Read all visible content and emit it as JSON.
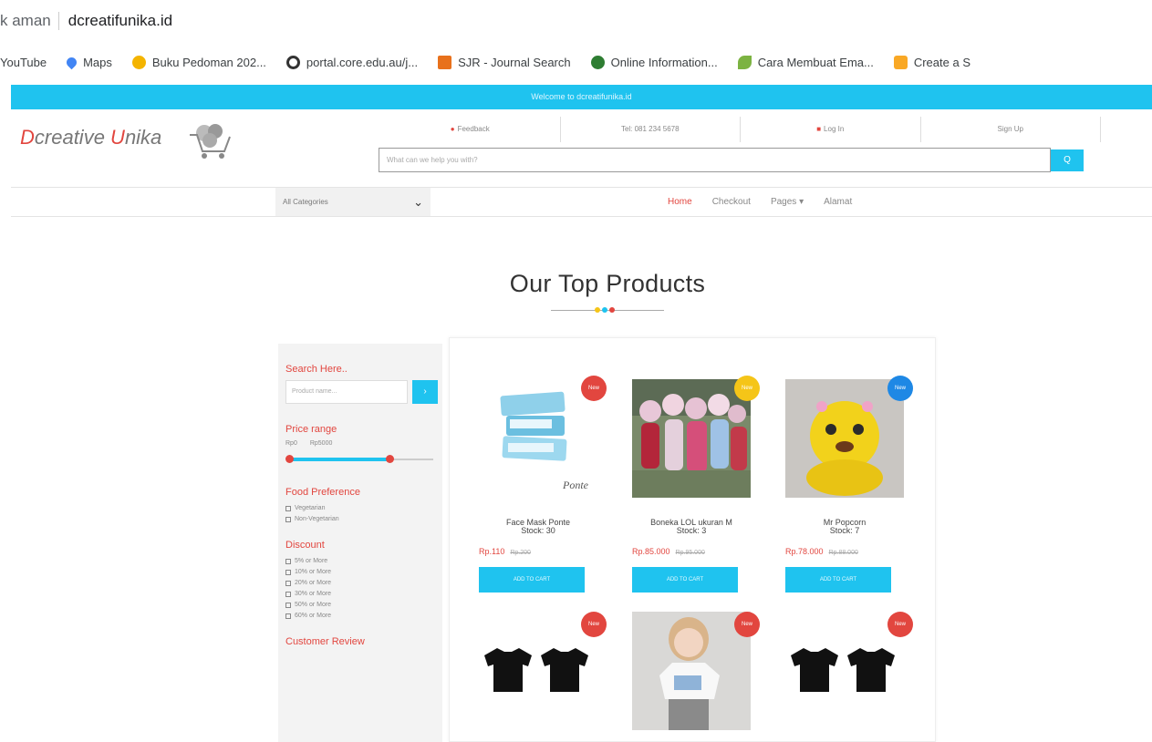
{
  "browser": {
    "security_label": "k aman",
    "url": "dcreatifunika.id",
    "bookmarks": [
      {
        "label": "YouTube",
        "icon": "youtube-icon",
        "color": "#e53935"
      },
      {
        "label": "Maps",
        "icon": "maps-icon",
        "color": "#4285f4"
      },
      {
        "label": "Buku Pedoman 202...",
        "icon": "book-icon",
        "color": "#f4b400"
      },
      {
        "label": "portal.core.edu.au/j...",
        "icon": "portal-icon",
        "color": "#333333"
      },
      {
        "label": "SJR - Journal Search",
        "icon": "sjr-icon",
        "color": "#e8711c"
      },
      {
        "label": "Online Information...",
        "icon": "info-icon",
        "color": "#2e7d32"
      },
      {
        "label": "Cara Membuat Ema...",
        "icon": "leaf-icon",
        "color": "#7cb342"
      },
      {
        "label": "Create a S",
        "icon": "create-icon",
        "color": "#f9a825"
      }
    ]
  },
  "site": {
    "welcome": "Welcome to dcreatifunika.id",
    "logo_first": "D",
    "logo_rest1": "creative ",
    "logo_u": "U",
    "logo_rest2": "nika",
    "top_links": [
      "Feedback",
      "Tel: 081 234 5678",
      "Log In",
      "Sign Up"
    ],
    "search_placeholder": "What can we help you with?",
    "search_btn": "Q",
    "category": "All Categories",
    "menu": [
      "Home",
      "Checkout",
      "Pages ▾",
      "Alamat"
    ],
    "accent": "#1fc3ef",
    "brand_red": "#e2463f"
  },
  "section": {
    "title": "Our Top Products"
  },
  "sidebar": {
    "search_heading": "Search Here..",
    "search_placeholder": "Product name...",
    "price_heading": "Price range",
    "price_min": "Rp0",
    "price_max": "Rp5000",
    "price_range_fraction": [
      0.0,
      0.7
    ],
    "food_heading": "Food Preference",
    "food_options": [
      "Vegetarian",
      "Non-Vegetarian"
    ],
    "discount_heading": "Discount",
    "discount_options": [
      "5% or More",
      "10% or More",
      "20% or More",
      "30% or More",
      "50% or More",
      "60% or More"
    ],
    "review_heading": "Customer Review"
  },
  "products": [
    {
      "name": "Face Mask Ponte",
      "stock": "Stock: 30",
      "price": "Rp.110",
      "old_price": "Rp.200",
      "button": "ADD TO CART",
      "badge": "New",
      "badge_color": "#e2463f"
    },
    {
      "name": "Boneka LOL ukuran M",
      "stock": "Stock: 3",
      "price": "Rp.85.000",
      "old_price": "Rp.95.000",
      "button": "ADD TO CART",
      "badge": "New",
      "badge_color": "#f5c518"
    },
    {
      "name": "Mr Popcorn",
      "stock": "Stock: 7",
      "price": "Rp.78.000",
      "old_price": "Rp.88.000",
      "button": "ADD TO CART",
      "badge": "New",
      "badge_color": "#1e88e5"
    },
    {
      "name": "",
      "stock": "",
      "price": "",
      "old_price": "",
      "button": "",
      "badge": "New",
      "badge_color": "#e2463f"
    },
    {
      "name": "",
      "stock": "",
      "price": "",
      "old_price": "",
      "button": "",
      "badge": "New",
      "badge_color": "#e2463f"
    },
    {
      "name": "",
      "stock": "",
      "price": "",
      "old_price": "",
      "button": "",
      "badge": "New",
      "badge_color": "#e2463f"
    }
  ]
}
